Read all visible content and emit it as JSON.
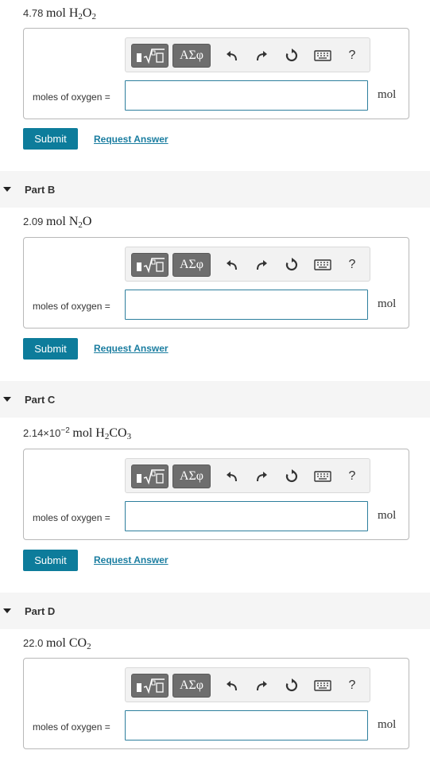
{
  "toolbar": {
    "template_icon": "template-radical-icon",
    "greek_label": "ΑΣφ",
    "undo_icon": "undo-icon",
    "redo_icon": "redo-icon",
    "reset_icon": "reset-icon",
    "keyboard_icon": "keyboard-icon",
    "help_label": "?"
  },
  "common": {
    "field_label": "moles of oxygen =",
    "unit": "mol",
    "submit_label": "Submit",
    "request_label": "Request Answer",
    "input_value": ""
  },
  "parts": [
    {
      "title": "",
      "amount": "4.78",
      "unit_word": "mol",
      "formula": "H2O2"
    },
    {
      "title": "Part B",
      "amount": "2.09",
      "unit_word": "mol",
      "formula": "N2O"
    },
    {
      "title": "Part C",
      "amount": "2.14×10",
      "exponent": "−2",
      "unit_word": "mol",
      "formula": "H2CO3"
    },
    {
      "title": "Part D",
      "amount": "22.0",
      "unit_word": "mol",
      "formula": "CO2"
    }
  ],
  "colors": {
    "accent": "#0d7c9b",
    "link": "#1a7da0",
    "input_border": "#2d7f9d"
  }
}
